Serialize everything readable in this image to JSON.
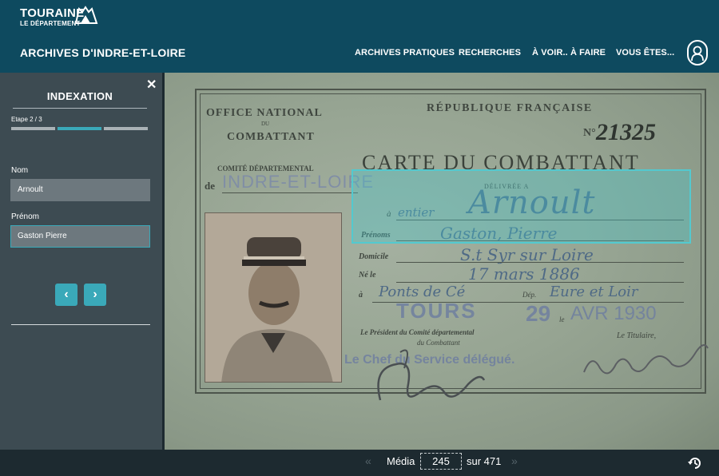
{
  "header": {
    "logo_line1": "TOURAINE",
    "logo_line2": "LE DÉPARTEMENT",
    "site_title": "ARCHIVES D'INDRE-ET-LOIRE",
    "nav": [
      "ARCHIVES PRATIQUES",
      "RECHERCHES",
      "À VOIR.. À FAIRE",
      "VOUS ÊTES..."
    ],
    "user_icon": "user-icon"
  },
  "sidebar": {
    "close_icon": "close-icon",
    "title": "INDEXATION",
    "step_label": "Etape 2 / 3",
    "step_current": 2,
    "step_total": 3,
    "fields": [
      {
        "label": "Nom",
        "value": "Arnoult"
      },
      {
        "label": "Prénom",
        "value": "Gaston Pierre"
      }
    ],
    "prev_icon": "chevron-left-icon",
    "next_icon": "chevron-right-icon"
  },
  "document": {
    "office": "OFFICE NATIONAL",
    "du": "DU",
    "combattant": "COMBATTANT",
    "republique": "RÉPUBLIQUE FRANÇAISE",
    "number_prefix": "N°",
    "number": "21325",
    "card_title": "CARTE DU COMBATTANT",
    "comite": "COMITÉ DÉPARTEMENTAL",
    "de": "de",
    "dept_stamp": "INDRE-ET-LOIRE",
    "delivree": "DÉLIVRÉE A",
    "prefix": "à",
    "hand_prefix": "entier",
    "hand_name": "Arnoult",
    "prenoms_label": "Prénoms",
    "hand_prenoms": "Gaston, Pierre",
    "domicile_label": "Domicile",
    "hand_domicile": "S.t Syr sur Loire",
    "ne_label": "Né le",
    "hand_ne": "17 mars 1886",
    "a_label": "à",
    "hand_lieu": "Ponts de Cé",
    "dep_label": "Dép.",
    "hand_dep": "Eure et Loir",
    "date_stamp_city": "TOURS",
    "date_stamp_day": "29",
    "date_stamp_le": "le",
    "date_stamp_month": "AVR 1930",
    "president": "Le Président du Comité départemental",
    "president2": "du Combattant",
    "titulaire": "Le Titulaire,",
    "stamp_service": "Le Chef du Service délégué."
  },
  "footer": {
    "media_label": "Média",
    "current_page": "245",
    "of_label": "sur 471",
    "prev_icon": "chevron-left-icon",
    "next_icon": "chevron-right-icon",
    "reset_icon": "history-icon"
  },
  "colors": {
    "header_bg": "#0e4a5f",
    "sidebar_bg": "#3d4b52",
    "accent": "#3aa9b9",
    "footer_bg": "#1d2a30"
  }
}
